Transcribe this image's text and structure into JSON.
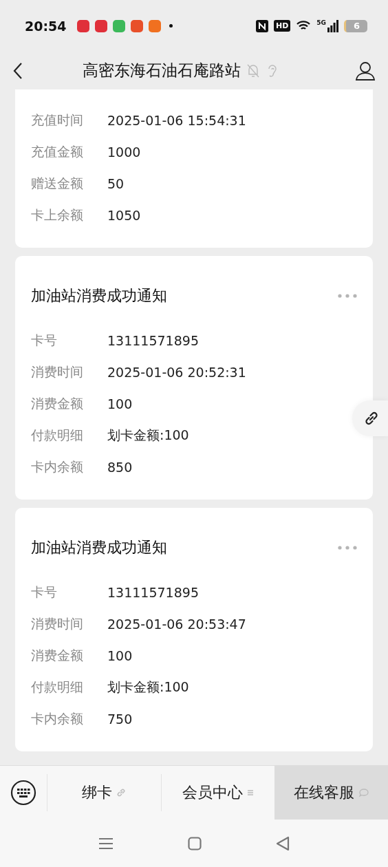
{
  "status_bar": {
    "time": "20:54",
    "network": "5G",
    "battery": "6",
    "hd": "HD",
    "apps": [
      {
        "color": "#e0303a"
      },
      {
        "color": "#e0303a"
      },
      {
        "color": "#3cb95a"
      },
      {
        "color": "#e8502a"
      },
      {
        "color": "#f07020"
      }
    ]
  },
  "header": {
    "title": "高密东海石油石庵路站"
  },
  "cards": [
    {
      "rows": [
        {
          "label": "充值时间",
          "value": "2025-01-06 15:54:31"
        },
        {
          "label": "充值金额",
          "value": "1000"
        },
        {
          "label": "赠送金额",
          "value": "50"
        },
        {
          "label": "卡上余额",
          "value": "1050"
        }
      ]
    },
    {
      "title": "加油站消费成功通知",
      "rows": [
        {
          "label": "卡号",
          "value": "13111571895"
        },
        {
          "label": "消费时间",
          "value": "2025-01-06 20:52:31"
        },
        {
          "label": "消费金额",
          "value": "100"
        },
        {
          "label": "付款明细",
          "value": "划卡金额:100"
        },
        {
          "label": "卡内余额",
          "value": "850"
        }
      ]
    },
    {
      "title": "加油站消费成功通知",
      "rows": [
        {
          "label": "卡号",
          "value": "13111571895"
        },
        {
          "label": "消费时间",
          "value": "2025-01-06 20:53:47"
        },
        {
          "label": "消费金额",
          "value": "100"
        },
        {
          "label": "付款明细",
          "value": "划卡金额:100"
        },
        {
          "label": "卡内余额",
          "value": "750"
        }
      ]
    }
  ],
  "menu": [
    {
      "label": "绑卡",
      "kind": "link",
      "selected": false
    },
    {
      "label": "会员中心",
      "kind": "list",
      "selected": false
    },
    {
      "label": "在线客服",
      "kind": "chat",
      "selected": true
    }
  ]
}
